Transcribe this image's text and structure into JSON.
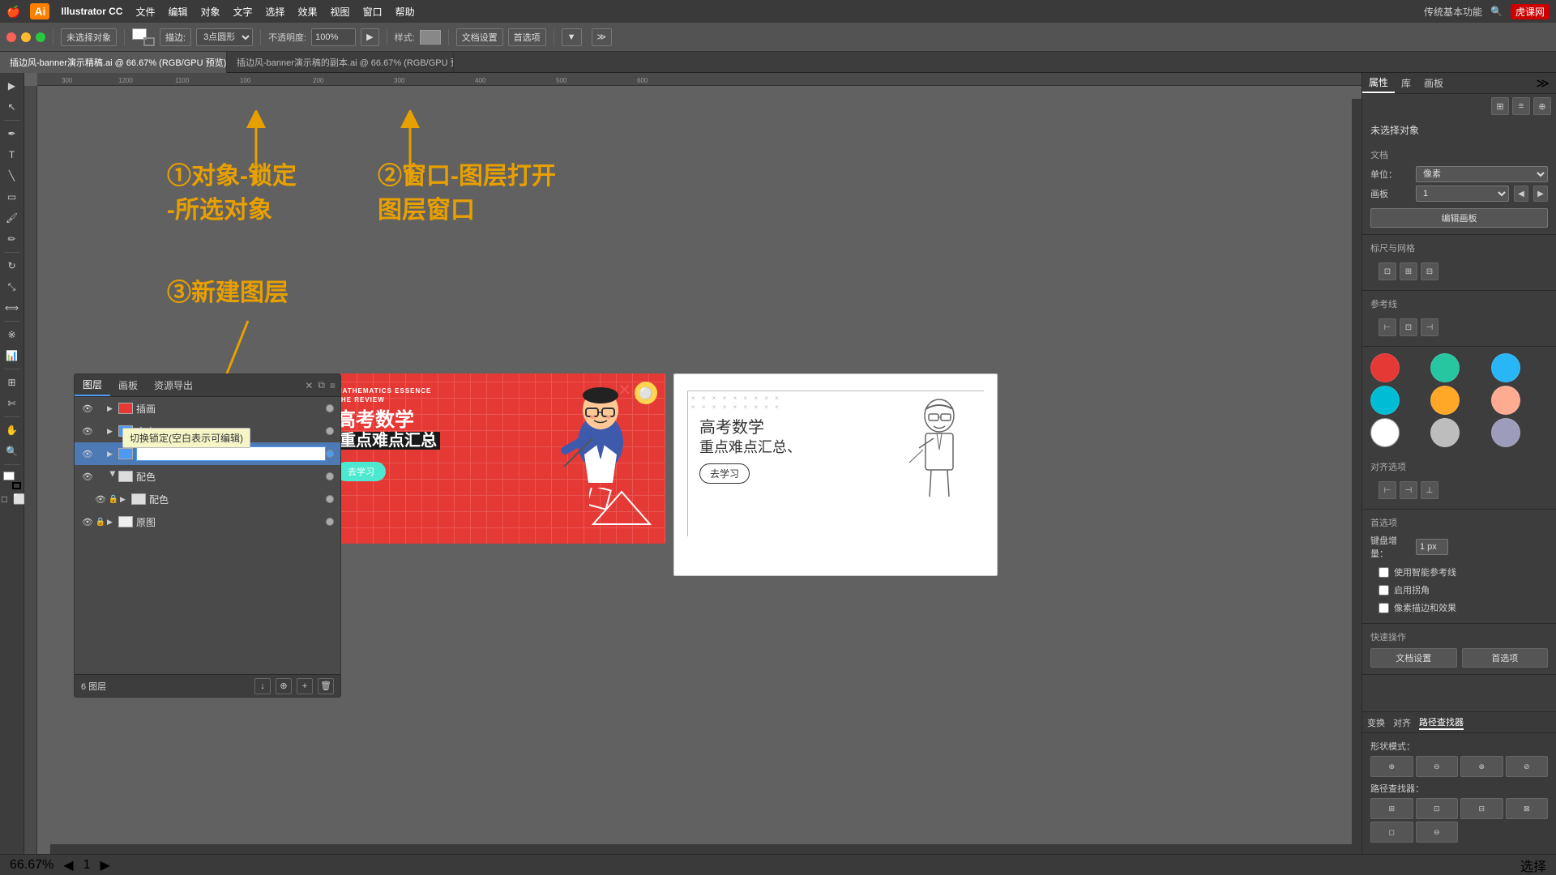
{
  "app": {
    "name": "Illustrator CC",
    "logo": "Ai",
    "window_controls": [
      "close",
      "minimize",
      "fullscreen"
    ]
  },
  "menu": {
    "apple": "🍎",
    "items": [
      "Illustrator CC",
      "文件",
      "编辑",
      "对象",
      "文字",
      "选择",
      "效果",
      "视图",
      "窗口",
      "帮助"
    ]
  },
  "top_right": {
    "label": "传统基本功能",
    "search_icon": "🔍",
    "logo_site": "虎课网"
  },
  "toolbar": {
    "no_select_label": "未选择对象",
    "stroke_label": "描边:",
    "stroke_value": "3点圆形",
    "opacity_label": "不透明度:",
    "opacity_value": "100%",
    "style_label": "样式:",
    "doc_settings": "文档设置",
    "preferences": "首选项"
  },
  "tabs": [
    {
      "label": "插边风-banner演示精稿.ai @ 66.67% (RGB/GPU 预览)",
      "active": true
    },
    {
      "label": "插边风-banner演示稿的副本.ai @ 66.67% (RGB/GPU 预览)",
      "active": false
    }
  ],
  "annotations": {
    "step1": "①对象-锁定\n-所选对象",
    "step2": "②窗口-图层打开\n图层窗口",
    "step3": "③新建图层"
  },
  "layers_panel": {
    "title": "图层",
    "tabs": [
      "图层",
      "画板",
      "资源导出"
    ],
    "layers": [
      {
        "name": "插画",
        "eye": true,
        "lock": false,
        "color": "red",
        "dot": false
      },
      {
        "name": "文字",
        "eye": true,
        "lock": false,
        "color": "blue",
        "dot": false
      },
      {
        "name": "",
        "eye": true,
        "lock": false,
        "color": "blue",
        "dot": true,
        "editing": true
      },
      {
        "name": "配色",
        "eye": true,
        "lock": false,
        "color": "default",
        "dot": false,
        "expanded": true
      },
      {
        "name": "配色",
        "eye": true,
        "lock": true,
        "color": "default",
        "dot": false
      },
      {
        "name": "原图",
        "eye": true,
        "lock": true,
        "color": "default",
        "dot": false
      }
    ],
    "footer_info": "6 图层"
  },
  "tooltip": {
    "text": "切换锁定(空白表示可编辑)"
  },
  "right_panel": {
    "tabs": [
      "属性",
      "库",
      "画板"
    ],
    "title": "未选择对象",
    "document_section": {
      "label": "文档",
      "unit_label": "单位：",
      "unit_value": "像素",
      "artboard_label": "画板",
      "artboard_value": "1",
      "edit_artboard_btn": "编辑画板"
    },
    "grid_snap": {
      "label": "标尺与网格"
    },
    "guides": {
      "label": "参考线"
    },
    "align": {
      "label": "对齐选项"
    },
    "preferences_section": {
      "label": "首选项",
      "keyboard_label": "键盘增量：",
      "keyboard_value": "1 px",
      "smart_guides": "使用智能参考线",
      "round_corners": "启用拐角",
      "snap_pixel": "像素描边和效果"
    },
    "quick_actions": {
      "label": "快速操作",
      "doc_settings_btn": "文档设置",
      "preferences_btn": "首选项"
    },
    "bottom_tabs": [
      "变换",
      "对齐",
      "路径查找器"
    ],
    "shape_modes_label": "形状模式：",
    "path_finder_label": "路径查找器："
  },
  "swatches": [
    {
      "color": "#e53935",
      "name": "red"
    },
    {
      "color": "#26c6a0",
      "name": "teal"
    },
    {
      "color": "#29b6f6",
      "name": "light-blue"
    },
    {
      "color": "#00bcd4",
      "name": "cyan"
    },
    {
      "color": "#ffa726",
      "name": "orange"
    },
    {
      "color": "#ffab91",
      "name": "peach"
    },
    {
      "color": "#ffffff",
      "name": "white"
    },
    {
      "color": "#bdbdbd",
      "name": "gray"
    },
    {
      "color": "#9e9cbb",
      "name": "lavender"
    }
  ],
  "status_bar": {
    "zoom": "66.67%",
    "tool": "选择",
    "artboard_nav": "1"
  },
  "banner": {
    "tag1": "MATHEMATICS ESSENCE",
    "tag2": "THE REVIEW",
    "title_line1": "高考数学",
    "title_line2": "重点难点汇总",
    "btn_text": "去学习"
  },
  "sketch": {
    "line1": "高考数学",
    "line2": "重点难点汇总、",
    "btn_text": "去学习"
  }
}
